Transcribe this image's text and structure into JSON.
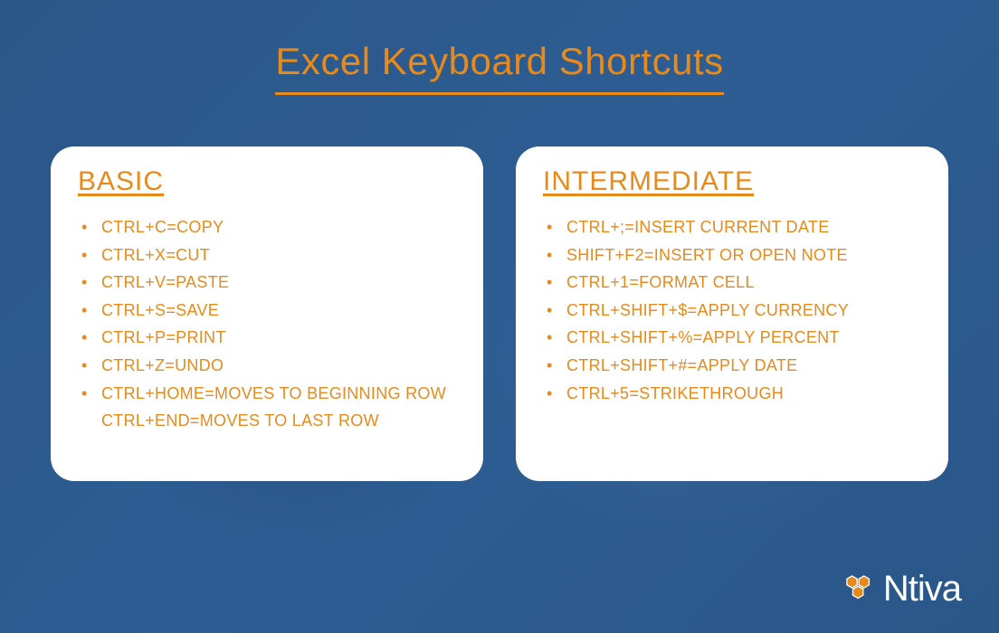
{
  "title": "Excel Keyboard Shortcuts",
  "colors": {
    "accent": "#e88a1a",
    "bg": "#2d5a8e",
    "card": "#ffffff"
  },
  "cards": {
    "basic": {
      "heading": "BASIC",
      "items": [
        "CTRL+C=COPY",
        "CTRL+X=CUT",
        "CTRL+V=PASTE",
        "CTRL+S=SAVE",
        "CTRL+P=PRINT",
        "CTRL+Z=UNDO"
      ],
      "last_item_line1": "CTRL+HOME=MOVES TO BEGINNING ROW",
      "last_item_line2": "CTRL+END=MOVES TO LAST ROW"
    },
    "intermediate": {
      "heading": "INTERMEDIATE",
      "items": [
        "CTRL+;=INSERT CURRENT DATE",
        "SHIFT+F2=INSERT OR OPEN NOTE",
        "CTRL+1=FORMAT CELL",
        "CTRL+SHIFT+$=APPLY CURRENCY",
        "CTRL+SHIFT+%=APPLY PERCENT",
        "CTRL+SHIFT+#=APPLY DATE",
        "CTRL+5=STRIKETHROUGH"
      ]
    }
  },
  "logo": {
    "brand": "Ntiva"
  }
}
